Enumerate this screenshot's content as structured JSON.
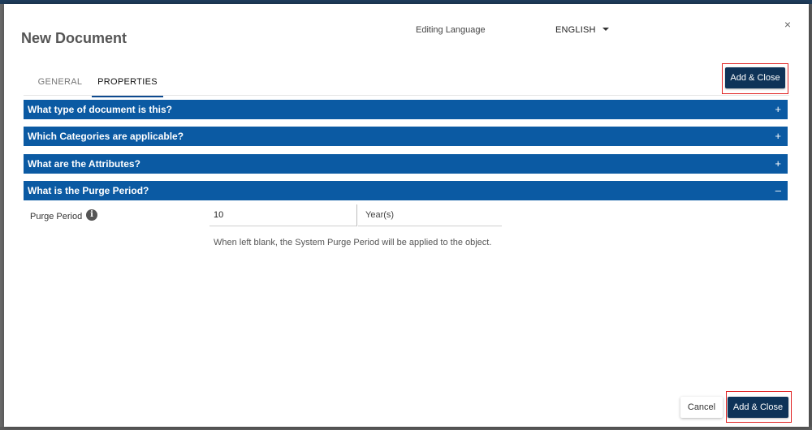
{
  "dialog": {
    "title": "New Document",
    "editing_language_label": "Editing Language",
    "language_value": "ENGLISH",
    "close_symbol": "×"
  },
  "tabs": [
    {
      "label": "GENERAL",
      "active": false
    },
    {
      "label": "PROPERTIES",
      "active": true
    }
  ],
  "actions": {
    "add_close_label": "Add & Close",
    "cancel_label": "Cancel"
  },
  "sections": [
    {
      "title": "What type of document is this?",
      "toggle": "+"
    },
    {
      "title": "Which Categories are applicable?",
      "toggle": "+"
    },
    {
      "title": "What are the Attributes?",
      "toggle": "+"
    },
    {
      "title": "What is the Purge Period?",
      "toggle": "–"
    }
  ],
  "purge": {
    "label": "Purge Period",
    "info_symbol": "i",
    "value": "10",
    "unit": "Year(s)",
    "helper": "When left blank, the System Purge Period will be applied to the object."
  },
  "colors": {
    "section_header_bg": "#0b5aa3",
    "primary_button_bg": "#0e3358",
    "highlight_border": "#e02020",
    "tab_active_underline": "#0d4a8f"
  }
}
